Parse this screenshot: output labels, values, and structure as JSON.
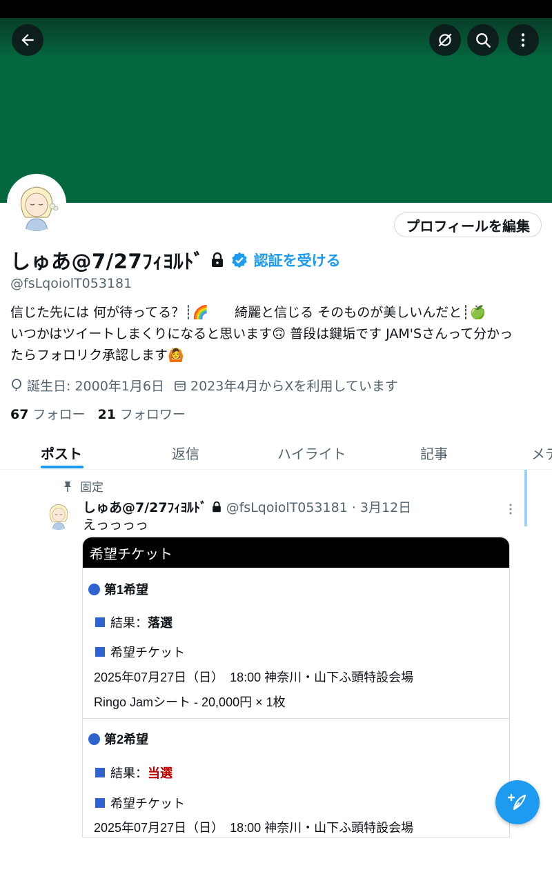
{
  "header": {
    "back_icon": "arrow-left-icon",
    "grok_icon": "grok-icon",
    "search_icon": "search-icon",
    "more_icon": "more-vertical-icon",
    "banner_color": "#04683f"
  },
  "profile": {
    "edit_button": "プロフィールを編集",
    "name": "しゅあ@7/27ﾌｨﾖﾙﾄﾞ",
    "verify_cta": "認証を受ける",
    "handle": "@fsLqoiolT053181",
    "bio_lines": [
      "信じた先には 何が待ってる？┊🌈　　綺麗と信じる そのものが美しいんだと┊🍏",
      "いつかはツイートしまくりになると思います🙃 普段は鍵垢です JAM'Sさんって分かっ",
      "たらフォロリク承認します🙆"
    ],
    "birthday": "誕生日: 2000年1月6日",
    "joined": "2023年4月からXを利用しています",
    "following_count": "67",
    "following_label": "フォロー",
    "followers_count": "21",
    "followers_label": "フォロワー"
  },
  "tabs": [
    "ポスト",
    "返信",
    "ハイライト",
    "記事",
    "メデ"
  ],
  "post": {
    "pinned_label": "固定",
    "author_name": "しゅあ@7/27ﾌｨﾖﾙﾄﾞ",
    "author_meta": "@fsLqoiolT053181 · 3月12日",
    "text": "えっっっっ",
    "card": {
      "header": "希望チケット",
      "choices": [
        {
          "title": "第1希望",
          "result_label": "結果：",
          "result_value": "落選",
          "ticket_label": "希望チケット",
          "datetime": "2025年07月27日（日）　18:00  神奈川・山下ふ頭特設会場",
          "seat": "Ringo Jamシート - 20,000円 × 1枚"
        },
        {
          "title": "第2希望",
          "result_label": "結果：",
          "result_value": "当選",
          "ticket_label": "希望チケット",
          "datetime": "2025年07月27日（日）　18:00  神奈川・山下ふ頭特設会場"
        }
      ]
    }
  },
  "colors": {
    "accent": "#1d9bf0",
    "win": "#c00000",
    "bullet": "#2f63d0"
  },
  "fab_icon": "compose-post-icon"
}
